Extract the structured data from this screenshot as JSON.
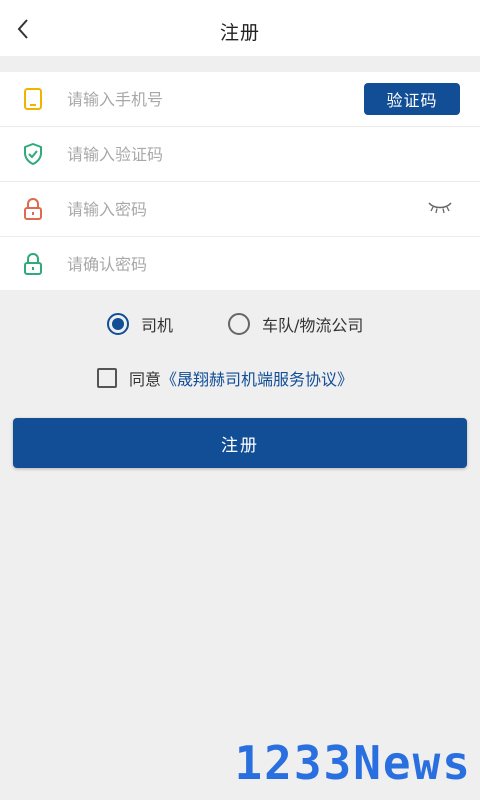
{
  "header": {
    "title": "注册",
    "back_icon": "chevron-left-icon"
  },
  "form": {
    "phone": {
      "placeholder": "请输入手机号",
      "value": "",
      "icon": "phone-icon",
      "icon_color": "#f0b400"
    },
    "code_button_label": "验证码",
    "verify": {
      "placeholder": "请输入验证码",
      "value": "",
      "icon": "shield-check-icon",
      "icon_color": "#2faa7a"
    },
    "password": {
      "placeholder": "请输入密码",
      "value": "",
      "icon": "lock-icon",
      "icon_color": "#e06a50",
      "toggle_icon": "eye-closed-icon"
    },
    "confirm": {
      "placeholder": "请确认密码",
      "value": "",
      "icon": "lock-icon",
      "icon_color": "#2faa7a"
    }
  },
  "roles": {
    "selected": "driver",
    "options": [
      {
        "id": "driver",
        "label": "司机"
      },
      {
        "id": "fleet",
        "label": "车队/物流公司"
      }
    ]
  },
  "agreement": {
    "checked": false,
    "prefix": "同意",
    "link_text": "《晟翔赫司机端服务协议》"
  },
  "submit_label": "注册",
  "watermark": "1233News",
  "colors": {
    "primary": "#124e96",
    "background": "#efefef",
    "card": "#ffffff",
    "watermark": "#2a6fe0"
  }
}
